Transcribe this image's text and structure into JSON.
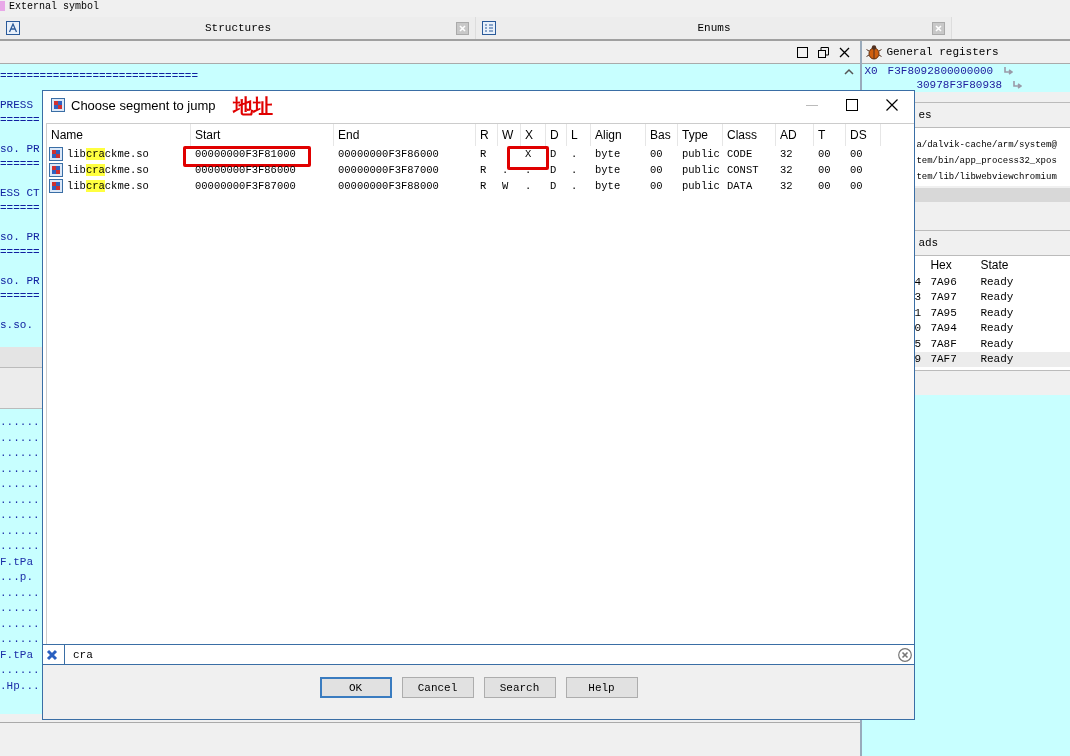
{
  "top_strip": {
    "label": "External symbol"
  },
  "tabs": [
    {
      "label": "Structures",
      "kind": "structures"
    },
    {
      "label": "Enums",
      "kind": "enums"
    }
  ],
  "disassembly": {
    "blocks": [
      [
        "=============================="
      ],
      [
        "PRESS",
        "======"
      ],
      [
        "so. PR",
        "======"
      ],
      [
        "ESS CT",
        "======"
      ],
      [
        "so. PR",
        "======"
      ],
      [
        "so. PR",
        "======"
      ],
      [
        "s.so."
      ]
    ]
  },
  "hex_view": {
    "lines": [
      "......",
      "......",
      "......",
      "......",
      "......",
      "......",
      "......",
      "......",
      "......",
      "F.tPa",
      "...p.",
      "......",
      "......",
      "......",
      "......",
      "F.tPa",
      "......",
      ".Hp..."
    ]
  },
  "registers": {
    "title": "General registers",
    "rows": [
      {
        "name": "X0",
        "value": "F3F8092800000000"
      },
      {
        "value": "30978F3F80938"
      }
    ]
  },
  "modules": {
    "title": "es",
    "paths": [
      "a/dalvik-cache/arm/system@",
      "tem/bin/app_process32_xpos",
      "tem/lib/libwebviewchromium"
    ]
  },
  "threads": {
    "title": "ads",
    "columns": [
      "Hex",
      "State"
    ],
    "rows": [
      {
        "id": "4",
        "hex": "7A96",
        "state": "Ready",
        "selected": false
      },
      {
        "id": "3",
        "hex": "7A97",
        "state": "Ready",
        "selected": false
      },
      {
        "id": "1",
        "hex": "7A95",
        "state": "Ready",
        "selected": false
      },
      {
        "id": "0",
        "hex": "7A94",
        "state": "Ready",
        "selected": false
      },
      {
        "id": "5",
        "hex": "7A8F",
        "state": "Ready",
        "selected": false
      },
      {
        "id": "9",
        "hex": "7AF7",
        "state": "Ready",
        "selected": true
      }
    ]
  },
  "dialog": {
    "title": "Choose segment to jump",
    "annotation": "地址",
    "columns": [
      "Name",
      "Start",
      "End",
      "R",
      "W",
      "X",
      "D",
      "L",
      "Align",
      "Bas",
      "Type",
      "Class",
      "AD",
      "T",
      "DS"
    ],
    "rows": [
      {
        "name_before": "lib",
        "name_match": "cra",
        "name_after": "ckme.so",
        "start": "00000000F3F81000",
        "end": "00000000F3F86000",
        "r": "R",
        "x": "X",
        "d": "D",
        "l": ".",
        "align": "byte",
        "base": "00",
        "type": "public",
        "class": "CODE",
        "ad": "32",
        "t": "00",
        "ds": "00",
        "start_boxed": true,
        "x_boxed": true
      },
      {
        "name_before": "lib",
        "name_match": "cra",
        "name_after": "ckme.so",
        "start": "00000000F3F86000",
        "end": "00000000F3F87000",
        "r": "R",
        "w": ".",
        "x": ".",
        "d": "D",
        "l": ".",
        "align": "byte",
        "base": "00",
        "type": "public",
        "class": "CONST",
        "ad": "32",
        "t": "00",
        "ds": "00",
        "start_boxed": false,
        "x_boxed": false
      },
      {
        "name_before": "lib",
        "name_match": "cra",
        "name_after": "ckme.so",
        "start": "00000000F3F87000",
        "end": "00000000F3F88000",
        "r": "R",
        "w": "W",
        "x": ".",
        "d": "D",
        "l": ".",
        "align": "byte",
        "base": "00",
        "type": "public",
        "class": "DATA",
        "ad": "32",
        "t": "00",
        "ds": "00",
        "start_boxed": false,
        "x_boxed": false
      }
    ],
    "filter": {
      "value": "cra"
    },
    "buttons": [
      {
        "label": "OK",
        "default": true
      },
      {
        "label": "Cancel",
        "default": false
      },
      {
        "label": "Search",
        "default": false
      },
      {
        "label": "Help",
        "default": false
      }
    ]
  }
}
